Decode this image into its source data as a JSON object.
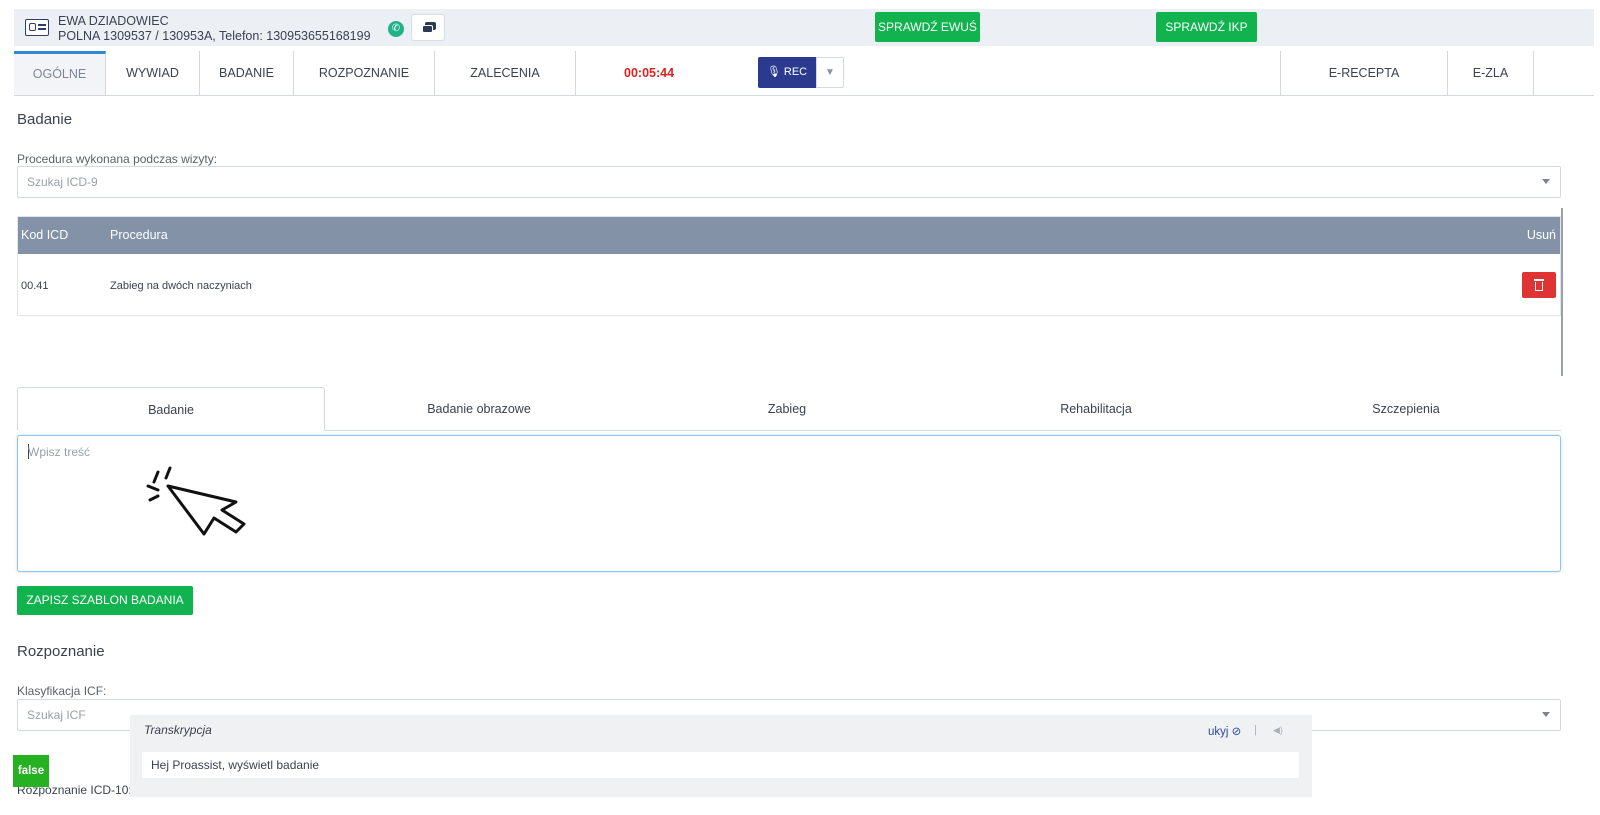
{
  "patient": {
    "name": "EWA DZIADOWIEC",
    "address": "POLNA 1309537 / 130953A, Telefon: 130953655168199",
    "check_ewus_label": "SPRAWDŹ EWUŚ",
    "check_ikp_label": "SPRAWDŹ IKP"
  },
  "nav": {
    "tabs": [
      {
        "label": "OGÓLNE"
      },
      {
        "label": "WYWIAD"
      },
      {
        "label": "BADANIE"
      },
      {
        "label": "ROZPOZNANIE"
      },
      {
        "label": "ZALECENIA"
      }
    ],
    "timer": "00:05:44",
    "rec_label": "REC",
    "right_tabs": [
      {
        "label": "E-RECEPTA"
      },
      {
        "label": "E-ZLA"
      }
    ]
  },
  "badanie": {
    "title": "Badanie",
    "procedure_label": "Procedura wykonana podczas wizyty:",
    "procedure_placeholder": "Szukaj ICD-9",
    "table": {
      "headers": {
        "code": "Kod ICD",
        "procedure": "Procedura",
        "remove": "Usuń"
      },
      "rows": [
        {
          "code": "00.41",
          "procedure": "Zabieg na dwóch naczyniach"
        }
      ]
    },
    "subtabs": [
      {
        "label": "Badanie"
      },
      {
        "label": "Badanie obrazowe"
      },
      {
        "label": "Zabieg"
      },
      {
        "label": "Rehabilitacja"
      },
      {
        "label": "Szczepienia"
      }
    ],
    "textarea_placeholder": "Wpisz treść",
    "save_template_label": "ZAPISZ SZABLON BADANIA"
  },
  "rozpoznanie": {
    "title": "Rozpoznanie",
    "icf_label": "Klasyfikacja ICF:",
    "icf_placeholder": "Szukaj ICF",
    "icd10_label": "Rozpoznanie ICD-10:"
  },
  "transcription": {
    "title": "Transkrypcja",
    "hide_label": "ukyj",
    "separator": "|",
    "text": "Hej Proassist, wyświetl badanie"
  },
  "debug_badge": "false",
  "colors": {
    "accent_green": "#11b34f",
    "rec_blue": "#2b3a8f",
    "timer_red": "#e02020",
    "table_header": "#8392a6",
    "delete_red": "#e03434"
  }
}
